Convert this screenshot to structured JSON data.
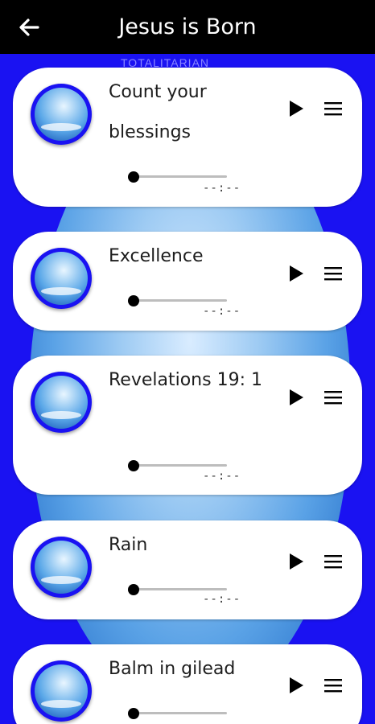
{
  "app_bar": {
    "title": "Jesus is Born",
    "back_icon": "arrow-left-icon"
  },
  "background": {
    "caption": "TOTALITARIAN"
  },
  "tracks": [
    {
      "title": "Count your blessings",
      "time": "--:--",
      "progress": 0
    },
    {
      "title": "Excellence",
      "time": "--:--",
      "progress": 0
    },
    {
      "title": "Revelations 19: 1",
      "time": "--:--",
      "progress": 0
    },
    {
      "title": "Rain",
      "time": "--:--",
      "progress": 0
    },
    {
      "title": "Balm in gilead",
      "time": "--:--",
      "progress": 0
    }
  ],
  "icons": {
    "play": "play-icon",
    "menu": "hamburger-menu-icon",
    "avatar": "globe-thumbnail-icon"
  },
  "colors": {
    "background": "#1a12f2",
    "app_bar": "#000000",
    "card": "#ffffff"
  }
}
